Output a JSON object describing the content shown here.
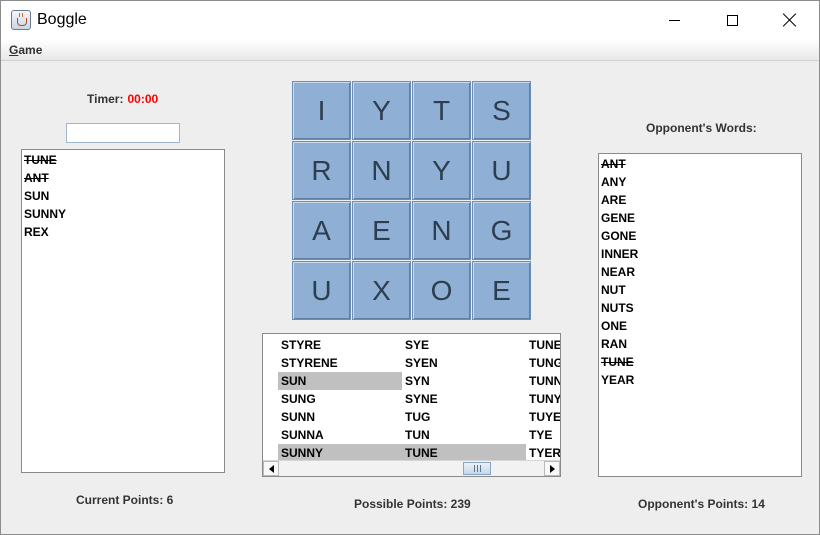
{
  "window": {
    "title": "Boggle"
  },
  "menu": {
    "game_prefix": "G",
    "game_rest": "ame"
  },
  "timer": {
    "label": "Timer:",
    "value": "00:00",
    "value_color": "#ff0000"
  },
  "input": {
    "value": ""
  },
  "player": {
    "words": [
      {
        "text": "TUNE",
        "struck": true
      },
      {
        "text": "ANT",
        "struck": true
      },
      {
        "text": "SUN",
        "struck": false
      },
      {
        "text": "SUNNY",
        "struck": false
      },
      {
        "text": "REX",
        "struck": false
      }
    ],
    "points_label": "Current Points: 6"
  },
  "board": {
    "tile_color": "#8fafd4",
    "tiles": [
      "I",
      "Y",
      "T",
      "S",
      "R",
      "N",
      "Y",
      "U",
      "A",
      "E",
      "N",
      "G",
      "U",
      "X",
      "O",
      "E"
    ]
  },
  "possible": {
    "columns": [
      [
        {
          "text": "STYRE",
          "selected": false
        },
        {
          "text": "STYRENE",
          "selected": false
        },
        {
          "text": "SUN",
          "selected": true
        },
        {
          "text": "SUNG",
          "selected": false
        },
        {
          "text": "SUNN",
          "selected": false
        },
        {
          "text": "SUNNA",
          "selected": false
        },
        {
          "text": "SUNNY",
          "selected": true
        }
      ],
      [
        {
          "text": "SYE",
          "selected": false
        },
        {
          "text": "SYEN",
          "selected": false
        },
        {
          "text": "SYN",
          "selected": false
        },
        {
          "text": "SYNE",
          "selected": false
        },
        {
          "text": "TUG",
          "selected": false
        },
        {
          "text": "TUN",
          "selected": false
        },
        {
          "text": "TUNE",
          "selected": true
        }
      ],
      [
        {
          "text": "TUNER",
          "selected": false
        },
        {
          "text": "TUNG",
          "selected": false
        },
        {
          "text": "TUNNY",
          "selected": false
        },
        {
          "text": "TUNY",
          "selected": false
        },
        {
          "text": "TUYER",
          "selected": false
        },
        {
          "text": "TYE",
          "selected": false
        },
        {
          "text": "TYER",
          "selected": false
        }
      ]
    ],
    "points_label": "Possible Points: 239"
  },
  "opponent": {
    "label": "Opponent's Words:",
    "words": [
      {
        "text": "ANT",
        "struck": true
      },
      {
        "text": "ANY",
        "struck": false
      },
      {
        "text": "ARE",
        "struck": false
      },
      {
        "text": "GENE",
        "struck": false
      },
      {
        "text": "GONE",
        "struck": false
      },
      {
        "text": "INNER",
        "struck": false
      },
      {
        "text": "NEAR",
        "struck": false
      },
      {
        "text": "NUT",
        "struck": false
      },
      {
        "text": "NUTS",
        "struck": false
      },
      {
        "text": "ONE",
        "struck": false
      },
      {
        "text": "RAN",
        "struck": false
      },
      {
        "text": "TUNE",
        "struck": true
      },
      {
        "text": "YEAR",
        "struck": false
      }
    ],
    "points_label": "Opponent's Points: 14"
  }
}
